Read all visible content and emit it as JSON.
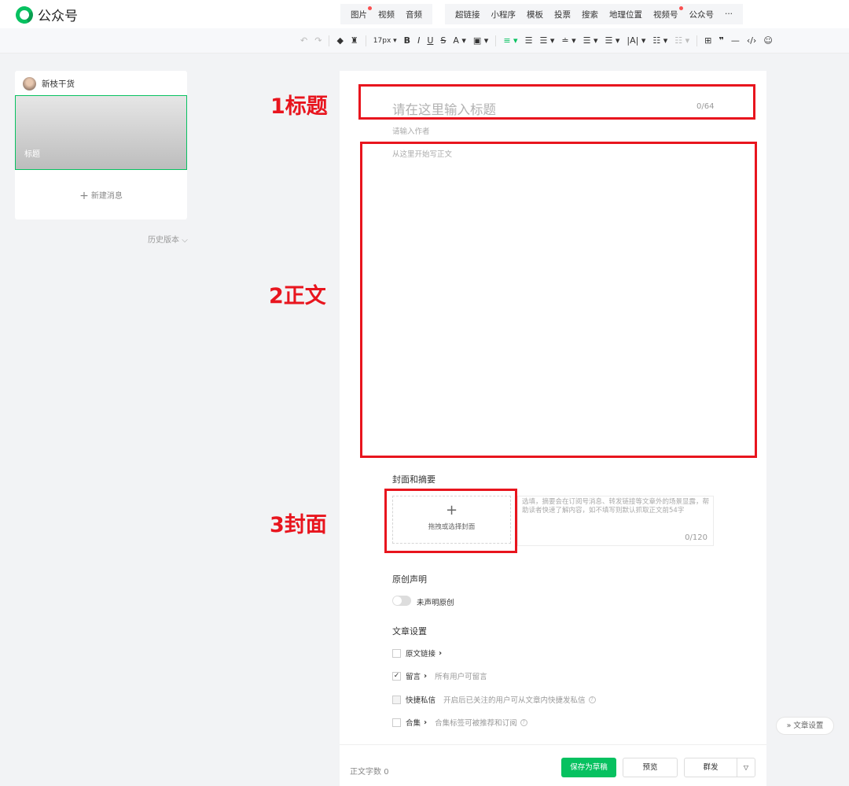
{
  "app": {
    "name": "公众号"
  },
  "insert_menu": {
    "group1": [
      "图片",
      "视频",
      "音频"
    ],
    "group2": [
      "超链接",
      "小程序",
      "模板",
      "投票",
      "搜索",
      "地理位置",
      "视频号",
      "公众号",
      "···"
    ]
  },
  "toolbar": {
    "undo": "↶",
    "redo": "↷",
    "font_size": "17px",
    "bold": "B",
    "italic": "I",
    "underline": "U",
    "strike": "S",
    "font_color": "A",
    "quote": "❞",
    "hr": "—",
    "code": "‹/›",
    "emoji": "☺"
  },
  "sidebar": {
    "account_name": "新枝干货",
    "thumb_title": "标题",
    "new_message": "新建消息",
    "history": "历史版本"
  },
  "editor": {
    "title_placeholder": "请在这里输入标题",
    "title_count": "0/64",
    "author_placeholder": "请输入作者",
    "body_placeholder": "从这里开始写正文",
    "cover_section": "封面和摘要",
    "cover_text": "拖拽或选择封面",
    "summary_placeholder": "选填，摘要会在订阅号消息、转发链接等文章外的场景显露，帮助读者快速了解内容，如不填写则默认抓取正文前54字",
    "summary_count": "0/120",
    "original_section": "原创声明",
    "original_toggle": "未声明原创",
    "settings_section": "文章设置",
    "options": [
      {
        "label": "原文链接",
        "desc": "",
        "checked": false
      },
      {
        "label": "留言",
        "desc": "所有用户可留言",
        "checked": true
      },
      {
        "label": "快捷私信",
        "desc": "开启后已关注的用户可从文章内快捷发私信",
        "checked": false
      },
      {
        "label": "合集",
        "desc": "合集标签可被推荐和订阅",
        "checked": false
      }
    ],
    "word_count_label": "正文字数",
    "word_count": "0"
  },
  "actions": {
    "save_draft": "保存为草稿",
    "preview": "预览",
    "publish": "群发"
  },
  "annotations": {
    "title": "1标题",
    "body": "2正文",
    "cover": "3封面"
  },
  "float_settings": "文章设置",
  "colors": {
    "accent": "#07c160",
    "annotation": "#e8151e"
  }
}
